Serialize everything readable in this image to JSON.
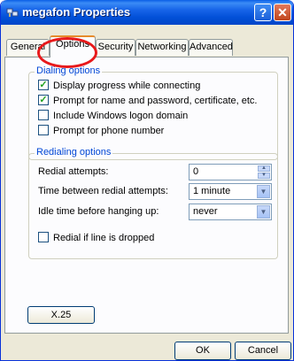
{
  "window": {
    "title": "megafon Properties",
    "help_label": "?",
    "close_label": "✕"
  },
  "tabs": [
    "General",
    "Options",
    "Security",
    "Networking",
    "Advanced"
  ],
  "active_tab": "Options",
  "dialing": {
    "title": "Dialing options",
    "items": [
      {
        "label": "Display progress while connecting",
        "checked": true
      },
      {
        "label": "Prompt for name and password, certificate, etc.",
        "checked": true
      },
      {
        "label": "Include Windows logon domain",
        "checked": false
      },
      {
        "label": "Prompt for phone number",
        "checked": false
      }
    ]
  },
  "redialing": {
    "title": "Redialing options",
    "attempts_label": "Redial attempts:",
    "attempts_value": "0",
    "time_label": "Time between redial attempts:",
    "time_value": "1 minute",
    "idle_label": "Idle time before hanging up:",
    "idle_value": "never",
    "redial_dropped": {
      "label": "Redial if line is dropped",
      "checked": false
    }
  },
  "buttons": {
    "x25": "X.25",
    "ok": "OK",
    "cancel": "Cancel"
  },
  "colors": {
    "title_bar": "#0a5ee6",
    "group_title": "#0046d5",
    "annotation": "#e8191b",
    "checkmark": "#21a121"
  }
}
